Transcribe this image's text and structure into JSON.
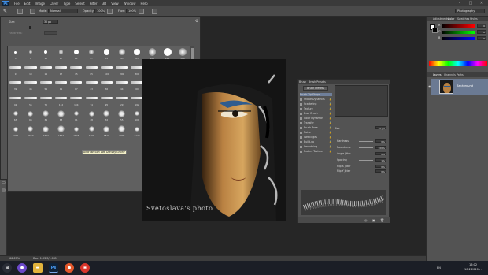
{
  "app": {
    "logo": "Ps",
    "workspace": "Photography"
  },
  "menu": [
    "File",
    "Edit",
    "Image",
    "Layer",
    "Type",
    "Select",
    "Filter",
    "3D",
    "View",
    "Window",
    "Help"
  ],
  "window_controls": {
    "minimize": "–",
    "maximize": "□",
    "close": "✕"
  },
  "options": {
    "mode_label": "Mode:",
    "mode_value": "Normal",
    "opacity_label": "Opacity:",
    "opacity_value": "100%",
    "flow_label": "Flow:",
    "flow_value": "100%"
  },
  "brush_picker": {
    "size_label": "Size:",
    "size_value": "30 px",
    "hardness_label": "Hardness:",
    "tooltip": "Airbrush Soft Low Density Grainy"
  },
  "brush_numbers": [
    "5",
    "9",
    "13",
    "17",
    "21",
    "27",
    "35",
    "45",
    "65",
    "100",
    "200",
    "300",
    "9",
    "13",
    "19",
    "17",
    "45",
    "65",
    "100",
    "200",
    "300",
    "14",
    "24",
    "27",
    "39",
    "46",
    "59",
    "11",
    "17",
    "23",
    "36",
    "44",
    "60",
    "14",
    "26",
    "33",
    "42",
    "55",
    "70",
    "112",
    "134",
    "74",
    "95",
    "29",
    "192",
    "36",
    "36",
    "33",
    "63",
    "66",
    "39",
    "63",
    "11",
    "48",
    "32",
    "55",
    "100",
    "75",
    "45",
    "1106",
    "1499",
    "1569",
    "1604",
    "1622",
    "1643",
    "1700",
    "1818",
    "1900",
    "2120",
    "2300",
    "2500"
  ],
  "document": {
    "watermark": "Svetoslava's photo"
  },
  "brush_panel": {
    "tabs": [
      "Brush",
      "Brush Presets"
    ],
    "presets_button": "Brush Presets",
    "options": [
      {
        "label": "Brush Tip Shape",
        "checked": null,
        "selected": true
      },
      {
        "label": "Shape Dynamics",
        "checked": true,
        "selected": false
      },
      {
        "label": "Scattering",
        "checked": true,
        "selected": false
      },
      {
        "label": "Texture",
        "checked": false,
        "selected": false
      },
      {
        "label": "Dual Brush",
        "checked": false,
        "selected": false
      },
      {
        "label": "Color Dynamics",
        "checked": false,
        "selected": false
      },
      {
        "label": "Transfer",
        "checked": false,
        "selected": false
      },
      {
        "label": "Brush Pose",
        "checked": false,
        "selected": false
      },
      {
        "label": "Noise",
        "checked": false,
        "selected": false
      },
      {
        "label": "Wet Edges",
        "checked": false,
        "selected": false
      },
      {
        "label": "Build-up",
        "checked": false,
        "selected": false
      },
      {
        "label": "Smoothing",
        "checked": true,
        "selected": false
      },
      {
        "label": "Protect Texture",
        "checked": false,
        "selected": false
      }
    ],
    "size_label": "Size",
    "size_value": "30 px",
    "sliders": [
      {
        "label": "Hardness",
        "value": "0%"
      },
      {
        "label": "Roundness",
        "value": "100%"
      },
      {
        "label": "Angle Jitter",
        "value": "0%"
      },
      {
        "label": "Spacing",
        "value": "1%"
      }
    ],
    "extra": [
      {
        "label": "Flip X Jitter",
        "value": "0%"
      },
      {
        "label": "Flip Y Jitter",
        "value": "0%"
      }
    ]
  },
  "color_panel": {
    "tabs": [
      "Adjustments",
      "Color",
      "Swatches",
      "Styles"
    ],
    "rows": [
      {
        "label": "R",
        "value": "0"
      },
      {
        "label": "G",
        "value": "0"
      },
      {
        "label": "B",
        "value": "0"
      }
    ]
  },
  "layers_panel": {
    "tabs": [
      "Layers",
      "Channels",
      "Paths"
    ],
    "layer_name": "Background"
  },
  "status": {
    "zoom": "66.67%",
    "doc": "Doc: 1.03M/1.03M"
  },
  "taskbar": {
    "lang": "EN",
    "time": "16:02",
    "date": "10.2.2020 г."
  }
}
